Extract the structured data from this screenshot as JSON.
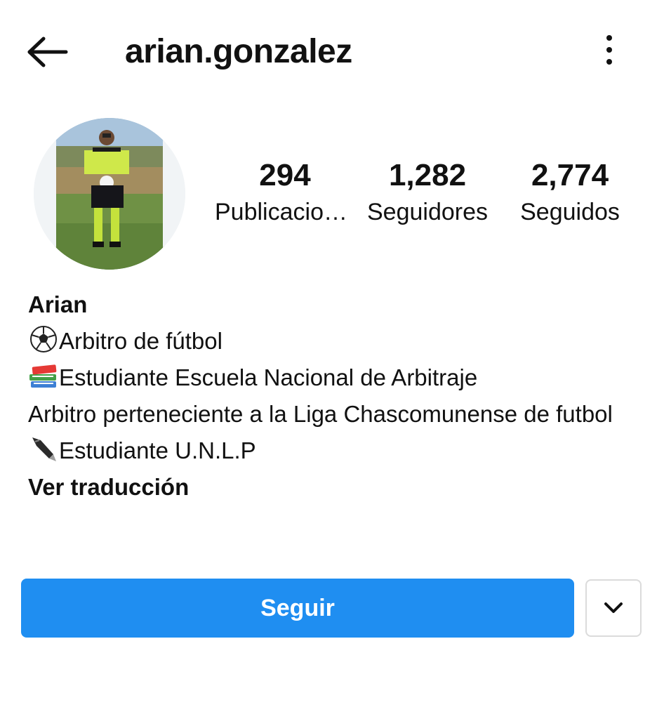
{
  "header": {
    "username": "arian.gonzalez",
    "back_icon": "arrow-left-icon",
    "more_icon": "vertical-dots-icon"
  },
  "profile": {
    "avatar": "profile-photo-referee"
  },
  "stats": [
    {
      "value": "294",
      "label": "Publicaciones"
    },
    {
      "value": "1,282",
      "label": "Seguidores"
    },
    {
      "value": "2,774",
      "label": "Seguidos"
    }
  ],
  "bio": {
    "name": "Arian",
    "line1": "Arbitro  de fútbol",
    "line1_icon": "soccer-ball-icon",
    "line2": "Estudiante Escuela  Nacional de Arbitraje",
    "line2_icon": "books-icon",
    "line3": "Arbitro  perteneciente a la Liga Chascomunense de futbol",
    "line4": "Estudiante  U.N.L.P",
    "line4_icon": "fountain-pen-icon",
    "translate": "Ver traducción"
  },
  "actions": {
    "follow": "Seguir",
    "dropdown_icon": "chevron-down-icon",
    "accent": "#1f8ef1"
  }
}
